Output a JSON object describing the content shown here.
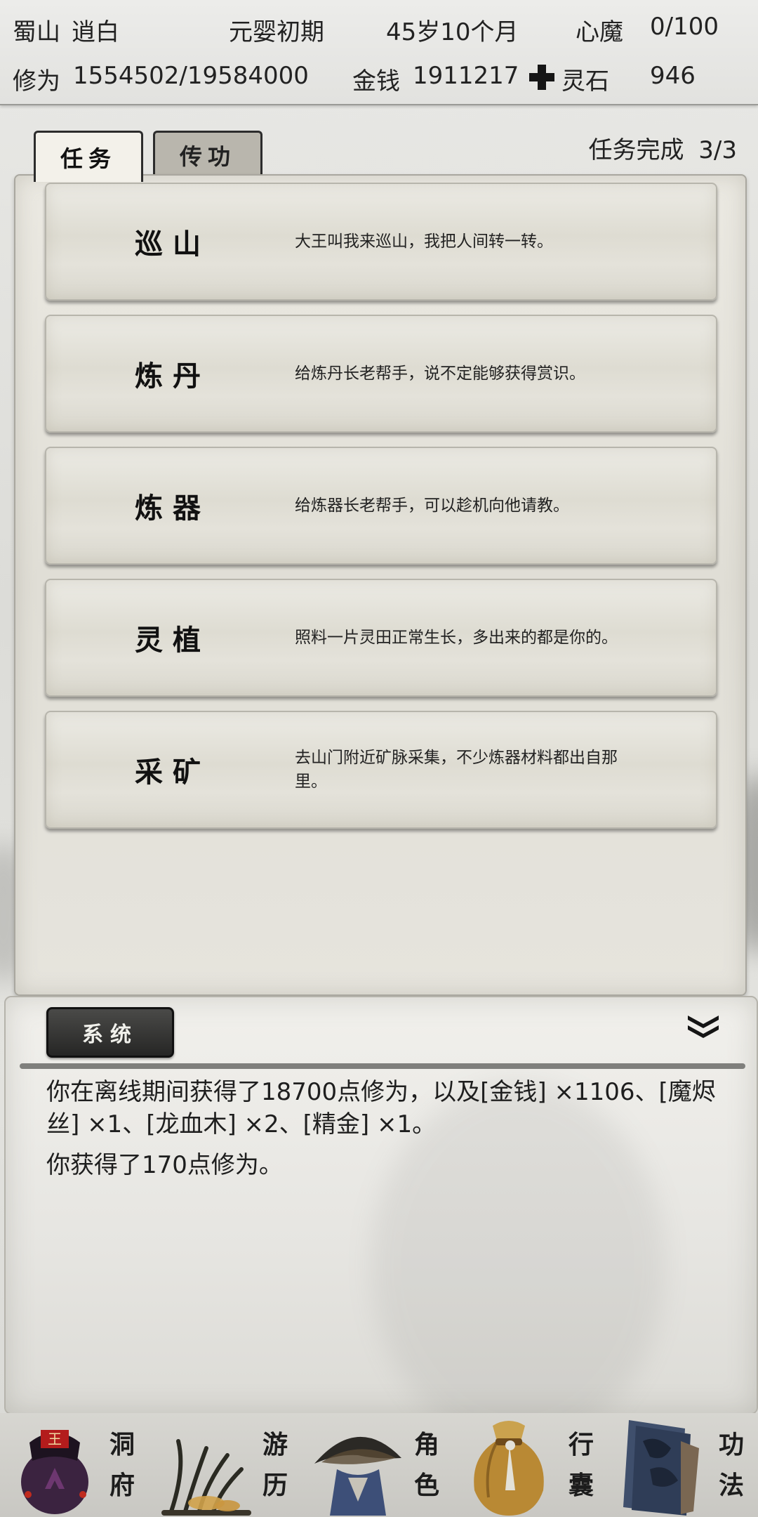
{
  "status": {
    "sect": "蜀山",
    "name": "逍白",
    "realm": "元婴初期",
    "age": "45岁10个月",
    "heart_demon_label": "心魔",
    "heart_demon_value": "0/100",
    "cultivation_label": "修为",
    "cultivation_value": "1554502/19584000",
    "money_label": "金钱",
    "money_value": "1911217",
    "spirit_stone_label": "灵石",
    "spirit_stone_value": "946",
    "spirit_stone_icon": "plus-stone-icon"
  },
  "tabs": [
    {
      "label": "任务",
      "active": true
    },
    {
      "label": "传功",
      "active": false
    }
  ],
  "task_progress": {
    "label": "任务完成",
    "value": "3/3"
  },
  "tasks": [
    {
      "title": "巡山",
      "desc": "大王叫我来巡山，我把人间转一转。"
    },
    {
      "title": "炼丹",
      "desc": "给炼丹长老帮手，说不定能够获得赏识。"
    },
    {
      "title": "炼器",
      "desc": "给炼器长老帮手，可以趁机向他请教。"
    },
    {
      "title": "灵植",
      "desc": "照料一片灵田正常生长，多出来的都是你的。"
    },
    {
      "title": "采矿",
      "desc": "去山门附近矿脉采集，不少炼器材料都出自那里。"
    }
  ],
  "log": {
    "channel_label": "系统",
    "messages": [
      "你在离线期间获得了18700点修为，以及[金钱] ×1106、[魔烬丝] ×1、[龙血木] ×2、[精金] ×1。",
      "你获得了170点修为。"
    ]
  },
  "nav": [
    {
      "label_top": "洞",
      "label_bottom": "府",
      "icon": "cave-dwelling-icon"
    },
    {
      "label_top": "游",
      "label_bottom": "历",
      "icon": "travel-grass-icon"
    },
    {
      "label_top": "角",
      "label_bottom": "色",
      "icon": "character-hat-icon"
    },
    {
      "label_top": "行",
      "label_bottom": "囊",
      "icon": "bag-icon"
    },
    {
      "label_top": "功",
      "label_bottom": "法",
      "icon": "books-icon"
    }
  ],
  "colors": {
    "background": "#e3e3df",
    "panel": "#e6e4dd",
    "card": "#dedcd2",
    "system_button": "#2e2e2d",
    "text": "#1a1a1a"
  }
}
